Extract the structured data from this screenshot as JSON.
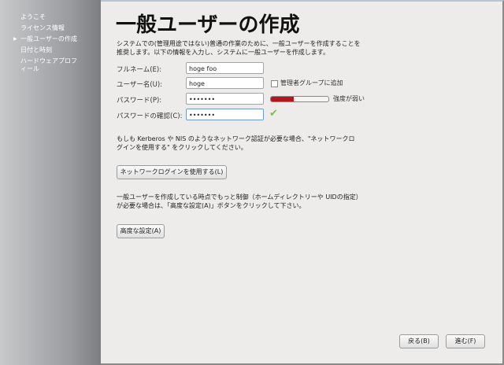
{
  "sidebar": {
    "items": [
      {
        "label": "ようこそ"
      },
      {
        "label": "ライセンス情報"
      },
      {
        "label": "一般ユーザーの作成",
        "current": true
      },
      {
        "label": "日付と時刻"
      },
      {
        "label": "ハードウェアプロフィール",
        "line1": "ハードウェアプロフ",
        "line2": "ィール"
      }
    ]
  },
  "main": {
    "title": "一般ユーザーの作成",
    "intro": "システムでの(管理用途ではない)普通の作業のために、一般ユーザーを作成することを推奨します。以下の情報を入力し、システムに一般ユーザーを作成します。",
    "fullname_label": "フルネーム(E):",
    "fullname_value": "hoge foo",
    "username_label": "ユーザー名(U):",
    "username_value": "hoge",
    "admin_checkbox_label": "管理者グループに追加",
    "admin_checked": false,
    "password_label": "パスワード(P):",
    "password_value": "•••••••",
    "strength_text": "強度が弱い",
    "strength_fraction": 0.4,
    "strength_color": "#b3161b",
    "confirm_label": "パスワードの確認(C):",
    "confirm_value": "•••••••",
    "network_text": "もしも Kerberos や NIS のようなネットワーク認証が必要な場合、\"ネットワークログインを使用する\" をクリックしてください。",
    "network_button": "ネットワークログインを使用する(L)",
    "advanced_text": "一般ユーザーを作成している時点でもっと制御（ホームディレクトリーや UIDの指定）が必要な場合は、「高度な設定(A)」ボタンをクリックして下さい。",
    "advanced_button": "高度な設定(A)"
  },
  "footer": {
    "back": "戻る(B)",
    "forward": "進む(F)"
  }
}
